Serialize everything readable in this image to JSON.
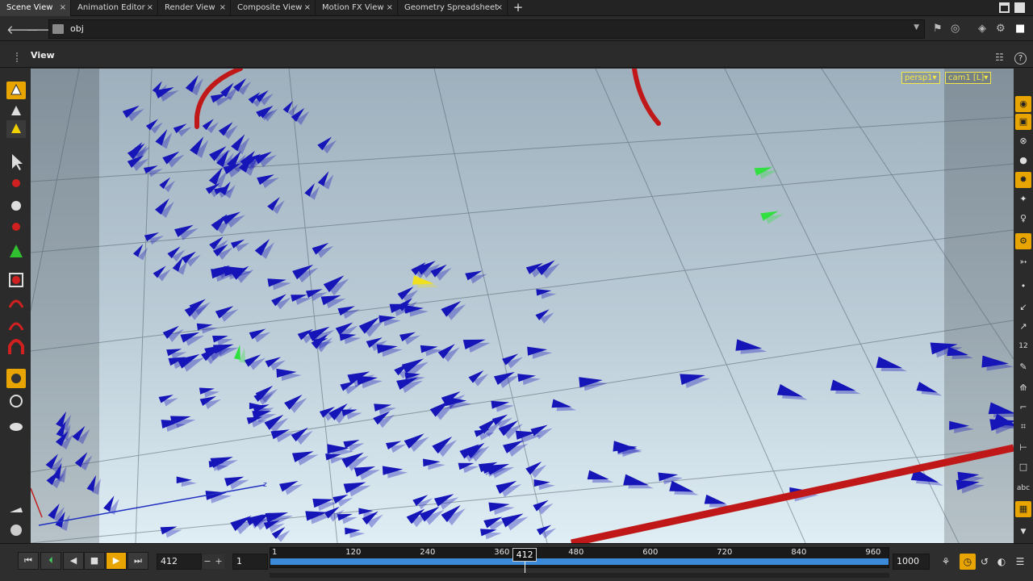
{
  "tabs": [
    {
      "label": "Scene View",
      "active": true
    },
    {
      "label": "Animation Editor",
      "active": false
    },
    {
      "label": "Render View",
      "active": false
    },
    {
      "label": "Composite View",
      "active": false
    },
    {
      "label": "Motion FX View",
      "active": false
    },
    {
      "label": "Geometry Spreadsheet",
      "active": false
    }
  ],
  "tab_close_glyph": "×",
  "tab_add_glyph": "+",
  "path": {
    "back_glyph": "🡐",
    "forward_glyph": "🡒",
    "value": "obj",
    "dropdown_glyph": "▼"
  },
  "view": {
    "title": "View",
    "help_glyph": "?"
  },
  "viewport": {
    "camera_menu": "persp1▾",
    "cam_menu": "cam1 [L]▾",
    "colors": {
      "arrow": "#1515b8",
      "selected_arrow": "#f0e020",
      "green_arrow": "#30e040",
      "guide_curve": "#c01818",
      "axis": "#2030c0"
    }
  },
  "timeline": {
    "current_frame": "412",
    "start_frame": "1",
    "end_frame": "1000",
    "ticks": [
      "1",
      "120",
      "240",
      "360",
      "480",
      "600",
      "720",
      "840",
      "960"
    ],
    "cursor_label": "412",
    "current_frame_value": 412,
    "range": [
      1,
      1000
    ],
    "minus_glyph": "−",
    "plus_glyph": "+"
  },
  "accent_color": "#e8a400"
}
